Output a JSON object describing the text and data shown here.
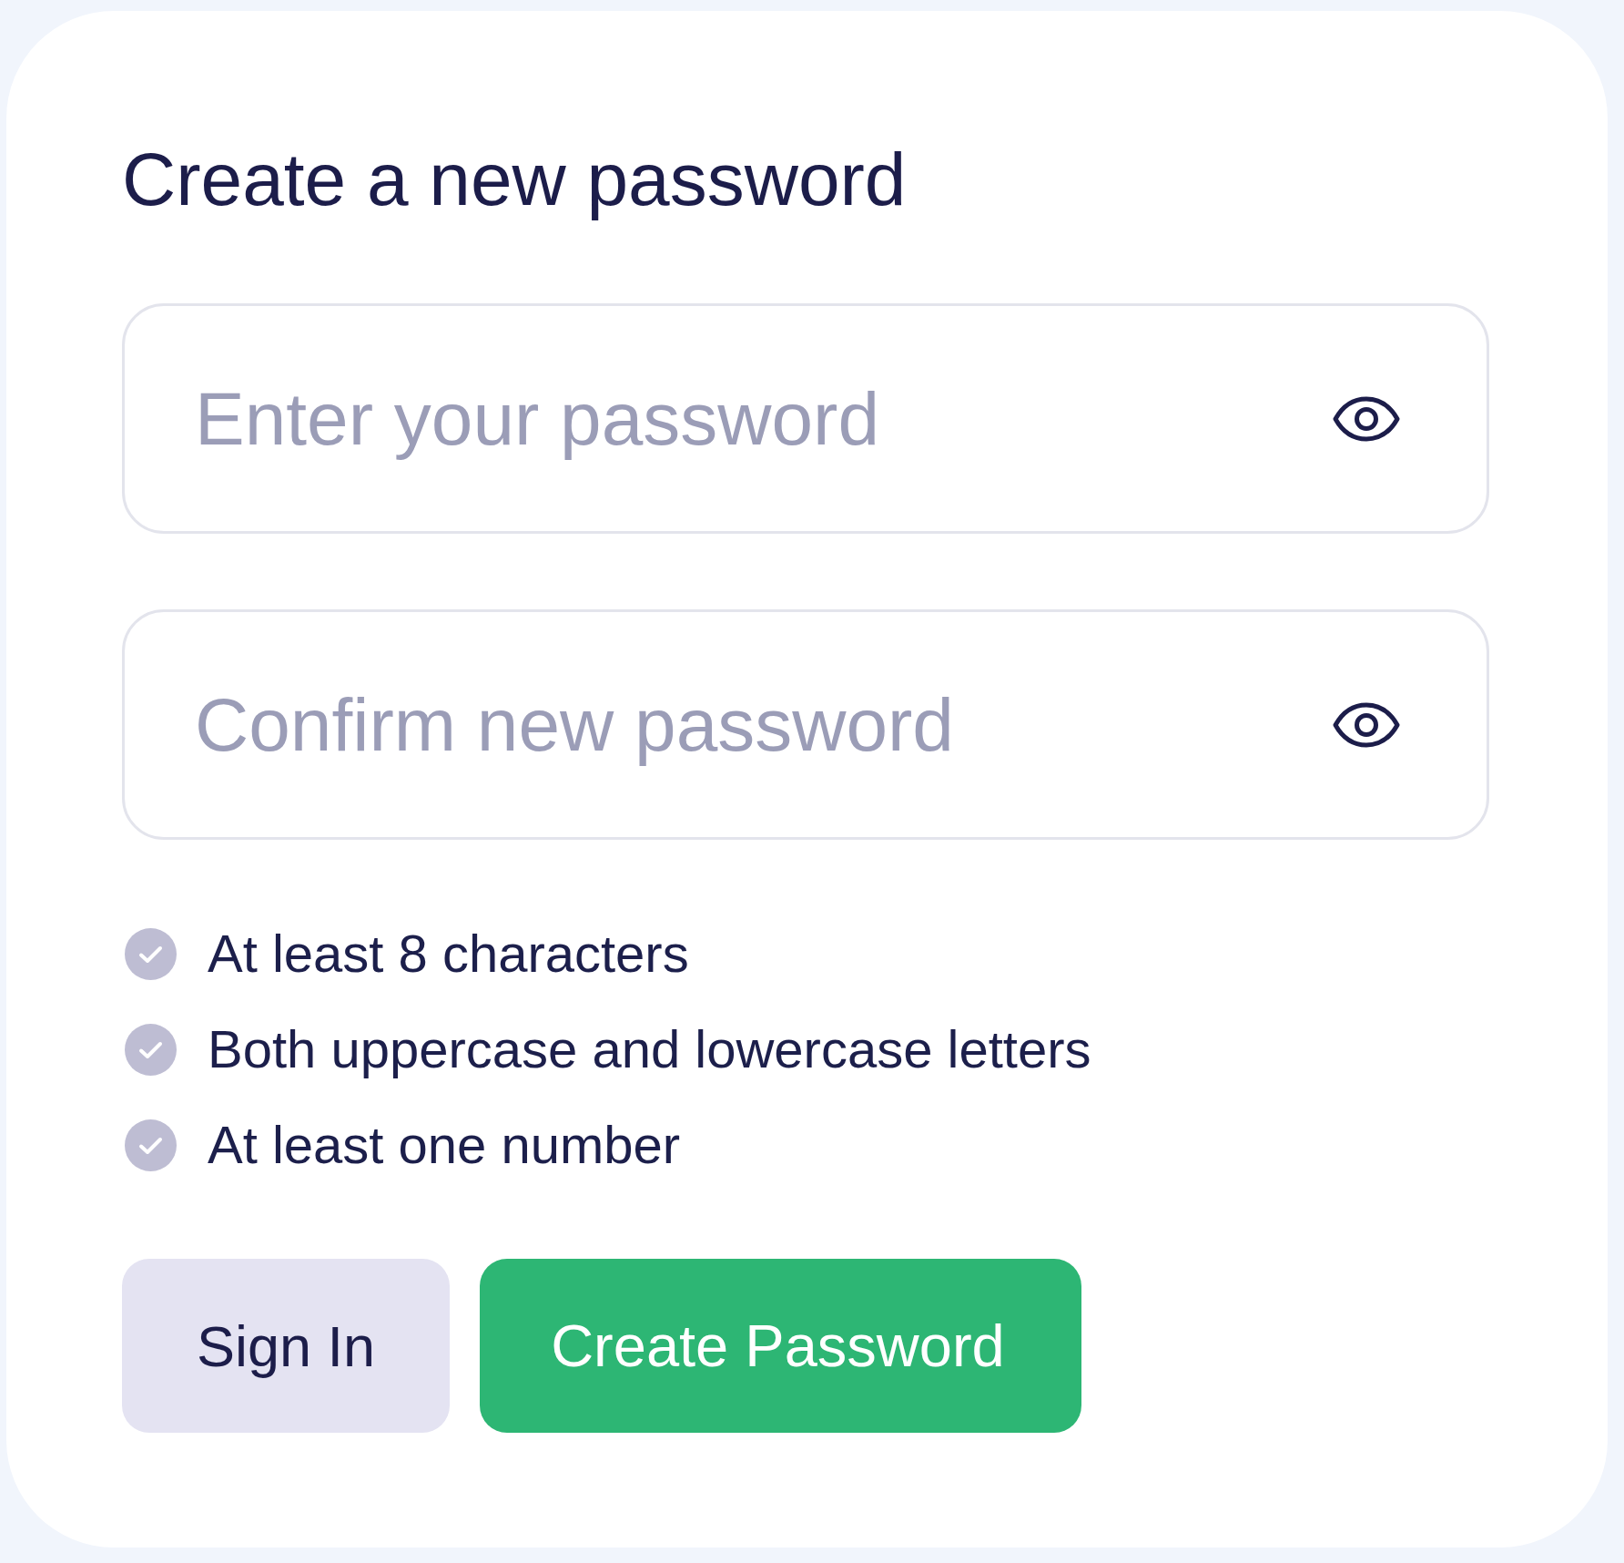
{
  "title": "Create a new password",
  "fields": [
    {
      "placeholder": "Enter your password"
    },
    {
      "placeholder": "Confirm new password"
    }
  ],
  "requirements": [
    {
      "label": "At least 8 characters",
      "met": false
    },
    {
      "label": "Both uppercase and lowercase letters",
      "met": false
    },
    {
      "label": "At least one number",
      "met": false
    }
  ],
  "buttons": [
    {
      "label": "Sign In",
      "kind": "secondary"
    },
    {
      "label": "Create Password",
      "kind": "primary"
    }
  ]
}
